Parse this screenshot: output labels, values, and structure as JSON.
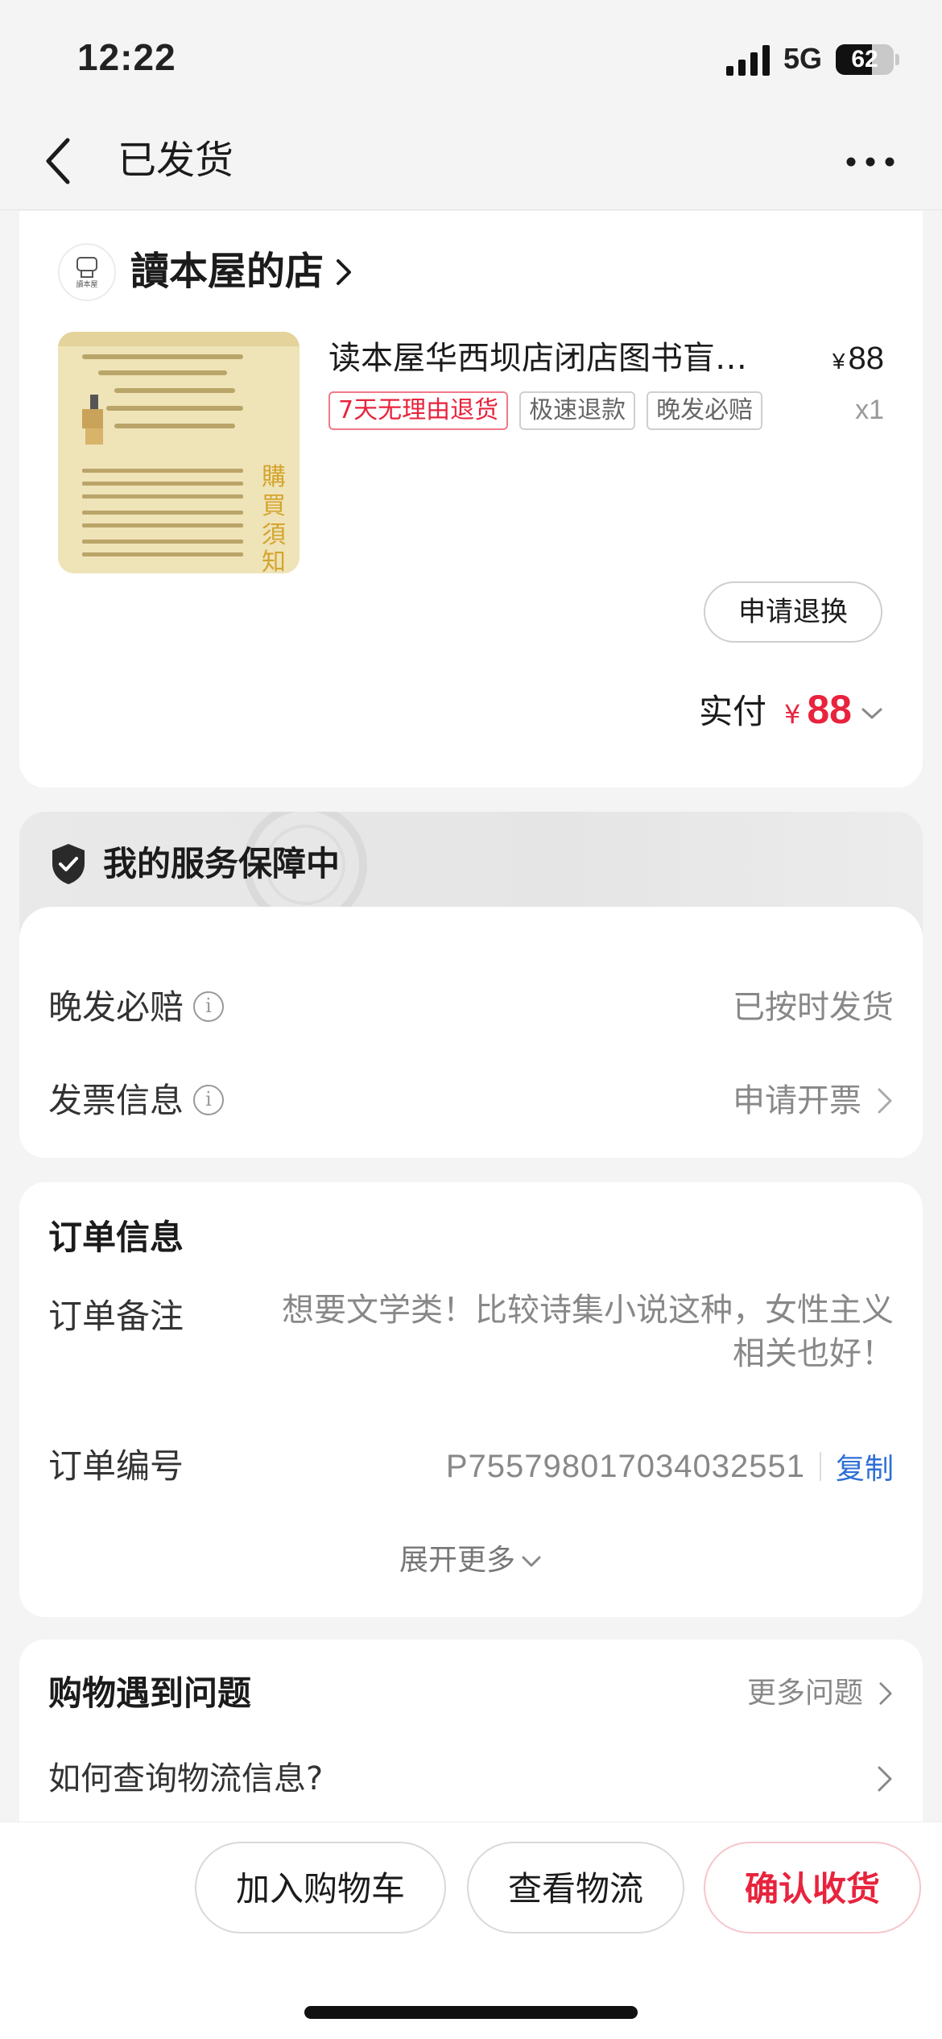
{
  "status_bar": {
    "time": "12:22",
    "network": "5G",
    "battery": "62",
    "battery_level": 0.62
  },
  "nav": {
    "title": "已发货",
    "back_icon": "chevron-left-icon",
    "more_icon": "more-dots-icon"
  },
  "shop": {
    "name": "讀本屋的店",
    "logo_text": "讀本屋"
  },
  "product": {
    "title": "读本屋华西坝店闭店图书盲…",
    "price_symbol": "¥",
    "price": "88",
    "quantity": "x1",
    "tags": [
      {
        "label": "7天无理由退货",
        "style": "red"
      },
      {
        "label": "极速退款",
        "style": "gray"
      },
      {
        "label": "晚发必赔",
        "style": "gray"
      }
    ],
    "image_caption": "購買須知",
    "refund_button": "申请退换",
    "paid_label": "实付",
    "paid_symbol": "¥",
    "paid_amount": "88"
  },
  "service": {
    "title": "我的服务保障中",
    "rows": [
      {
        "label": "晚发必赔",
        "value": "已按时发货"
      },
      {
        "label": "发票信息",
        "value": "申请开票"
      }
    ]
  },
  "order": {
    "heading": "订单信息",
    "note_label": "订单备注",
    "note_value": "想要文学类！比较诗集小说这种，女性主义相关也好！",
    "number_label": "订单编号",
    "number_value": "P755798017034032551",
    "copy_label": "复制",
    "expand_label": "展开更多"
  },
  "help": {
    "heading": "购物遇到问题",
    "more_label": "更多问题",
    "question": "如何查询物流信息?"
  },
  "actions": {
    "add_cart": "加入购物车",
    "view_logistics": "查看物流",
    "confirm_receipt": "确认收货"
  },
  "colors": {
    "accent_red": "#e8233d",
    "link_blue": "#2f6fd6",
    "background": "#f4f4f4"
  }
}
